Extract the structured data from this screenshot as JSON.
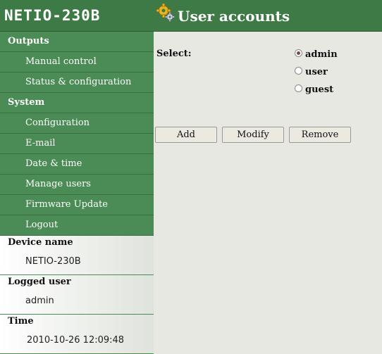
{
  "header": {
    "logo": "NETIO-230B",
    "title": "User accounts"
  },
  "sidebar": {
    "outputs_label": "Outputs",
    "outputs_items": [
      "Manual control",
      "Status & configuration"
    ],
    "system_label": "System",
    "system_items": [
      "Configuration",
      "E-mail",
      "Date & time",
      "Manage users",
      "Firmware Update",
      "Logout"
    ],
    "device_name_label": "Device name",
    "device_name": "NETIO-230B",
    "logged_user_label": "Logged user",
    "logged_user": "admin",
    "time_label": "Time",
    "time": "2010-10-26 12:09:48"
  },
  "main": {
    "select_label": "Select:",
    "users": [
      {
        "name": "admin",
        "selected": true
      },
      {
        "name": "user",
        "selected": false
      },
      {
        "name": "guest",
        "selected": false
      }
    ],
    "buttons": {
      "add": "Add",
      "modify": "Modify",
      "remove": "Remove"
    }
  },
  "colors": {
    "header_green": "#3d7a46",
    "menu_green": "#4b8b55",
    "content_bg": "#e6e8e1"
  }
}
